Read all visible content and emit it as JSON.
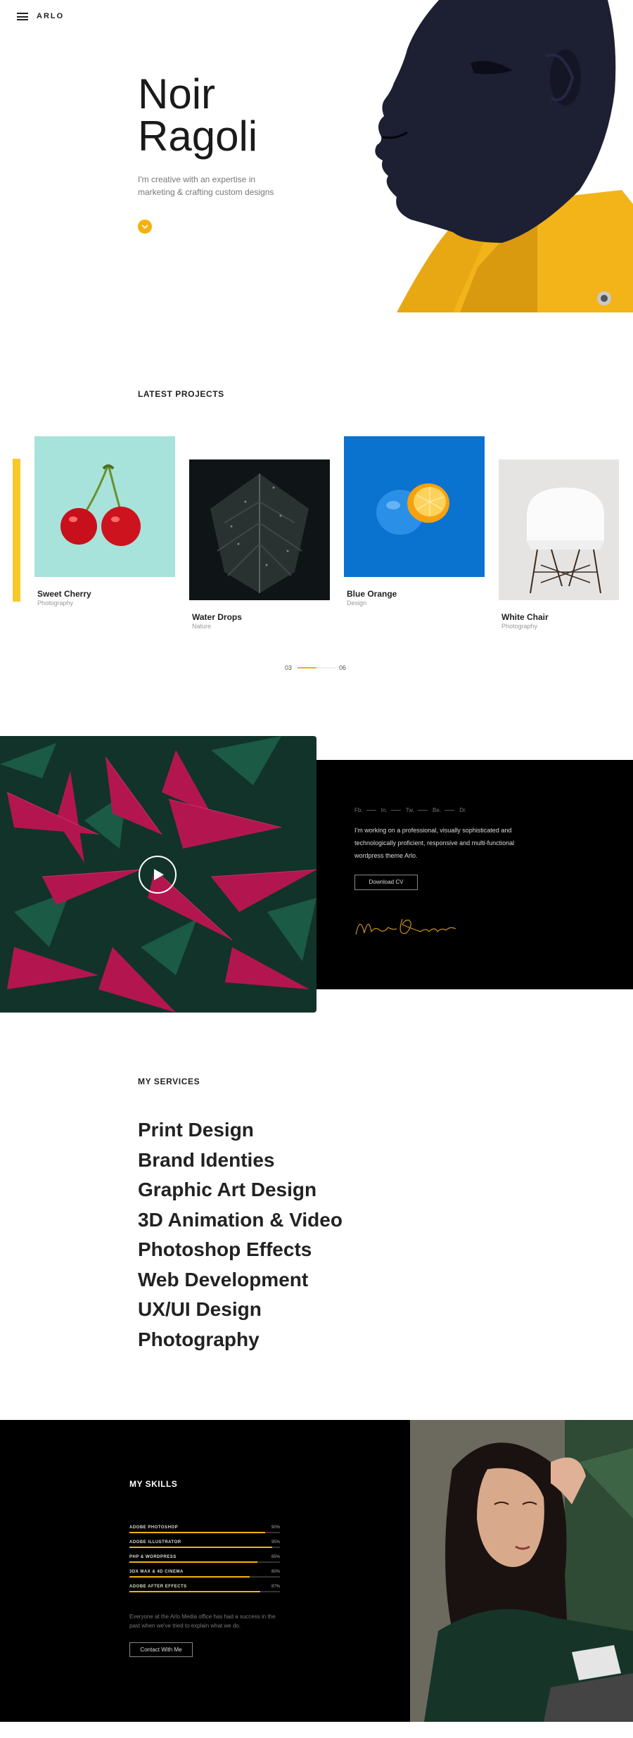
{
  "header": {
    "logo": "ARLO",
    "menu_icon": "hamburger-menu-icon"
  },
  "hero": {
    "title_line1": "Noir",
    "title_line2": "Ragoli",
    "description": "I'm creative with an expertise in marketing & crafting custom designs",
    "accent_color": "#f5b20f"
  },
  "projects": {
    "section_title": "LATEST PROJECTS",
    "items": [
      {
        "title": "Sweet Cherry",
        "category": "Photography"
      },
      {
        "title": "Water Drops",
        "category": "Nature"
      },
      {
        "title": "Blue Orange",
        "category": "Design"
      },
      {
        "title": "White Chair",
        "category": "Photography"
      }
    ],
    "pager": {
      "current": "03",
      "total": "06"
    }
  },
  "about": {
    "socials": [
      "Fb.",
      "In.",
      "Tw.",
      "Be.",
      "Dr."
    ],
    "text": "I'm working on a professional, visually sophisticated and technologically proficient, responsive and multi-functional wordpress theme Arlo.",
    "download_label": "Download CV",
    "signature": "Noir Ragoli"
  },
  "services": {
    "section_title": "MY SERVICES",
    "items": [
      "Print Design",
      "Brand Identies",
      "Graphic Art Design",
      "3D Animation & Video",
      "Photoshop Effects",
      "Web Development",
      "UX/UI Design",
      "Photography"
    ]
  },
  "skills": {
    "section_title": "MY SKILLS",
    "items": [
      {
        "name": "ADOBE PHOTOSHOP",
        "percent": "90%",
        "value": 0.9
      },
      {
        "name": "ADOBE ILLUSTRATOR",
        "percent": "95%",
        "value": 0.95
      },
      {
        "name": "PHP & WORDPRESS",
        "percent": "85%",
        "value": 0.85
      },
      {
        "name": "3DX MAX & 4D CINEMA",
        "percent": "80%",
        "value": 0.8
      },
      {
        "name": "ADOBE AFTER EFFECTS",
        "percent": "87%",
        "value": 0.87
      }
    ],
    "description": "Everyone at the Arlo Media office has had a success in the past when we've tried to explain what we do.",
    "contact_label": "Contact With Me"
  }
}
